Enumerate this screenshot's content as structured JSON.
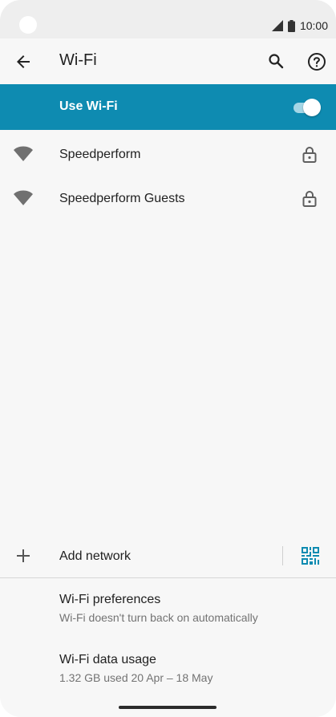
{
  "status_bar": {
    "time": "10:00",
    "icons": [
      "signal-icon",
      "battery-icon"
    ]
  },
  "app_bar": {
    "title": "Wi-Fi",
    "icons": [
      "back-arrow-icon",
      "search-icon",
      "help-icon"
    ]
  },
  "master_switch": {
    "label": "Use Wi-Fi",
    "enabled": true
  },
  "networks": [
    {
      "name": "Speedperform",
      "secured": true
    },
    {
      "name": "Speedperform Guests",
      "secured": true
    }
  ],
  "add_network": {
    "label": "Add network",
    "icons": [
      "plus-icon",
      "qr-code-icon"
    ]
  },
  "preferences": [
    {
      "title": "Wi-Fi preferences",
      "summary": "Wi-Fi doesn't turn back on automatically"
    },
    {
      "title": "Wi-Fi data usage",
      "summary": "1.32 GB used 20 Apr – 18 May"
    }
  ],
  "colors": {
    "accent": "#0e8bb1",
    "background": "#f7f7f7",
    "status_bar": "#eeeeee"
  }
}
